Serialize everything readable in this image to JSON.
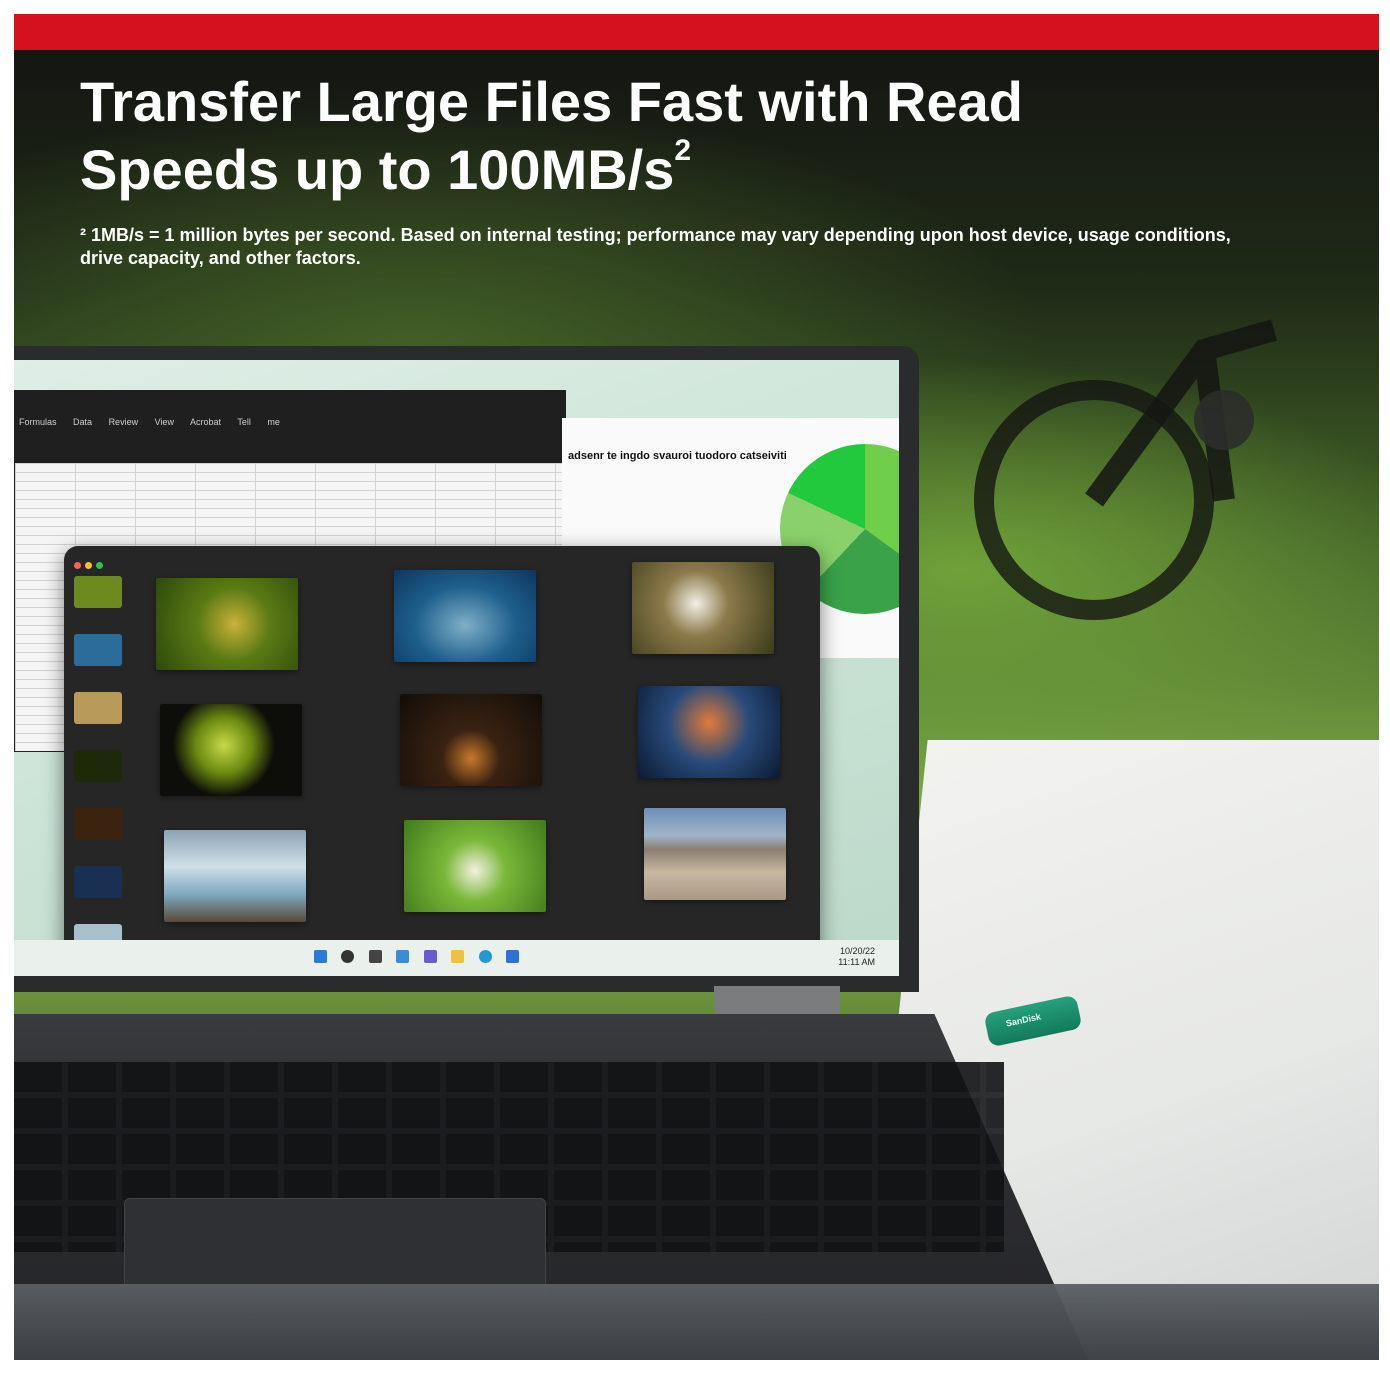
{
  "banner": {
    "heading_line1": "Transfer Large Files Fast with Read",
    "heading_line2": "Speeds up to 100MB/s",
    "heading_sup": "2",
    "footnote": "² 1MB/s = 1 million bytes per second. Based on internal testing; performance may vary depending upon host device, usage conditions, drive capacity, and other factors.",
    "accent_color": "#d5101f"
  },
  "screen": {
    "excel_tabs": [
      "Formulas",
      "Data",
      "Review",
      "View",
      "Acrobat",
      "Tell me"
    ],
    "doc_title": "adsenr te ingdo svauroi tuodoro catseiviti",
    "clock_date": "10/20/22",
    "clock_time": "11:11 AM"
  },
  "drive": {
    "label": "SanDisk"
  }
}
